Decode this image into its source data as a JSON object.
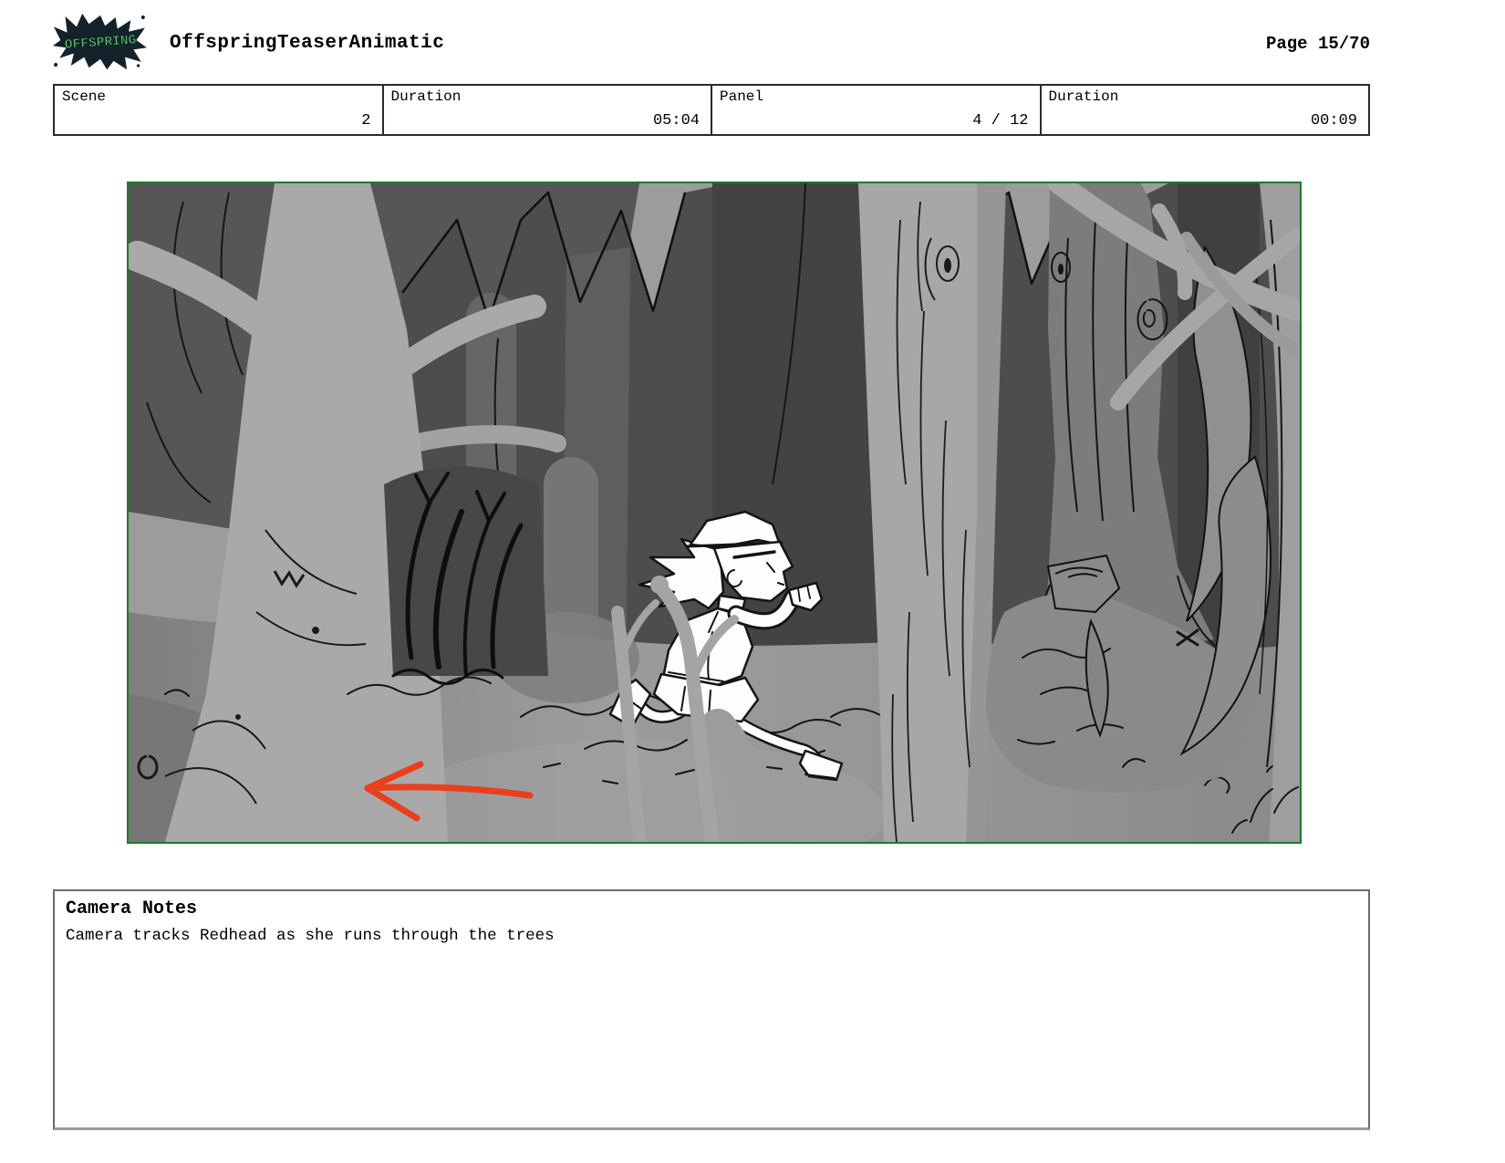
{
  "header": {
    "logo_text": "OFFSPRING",
    "title": "OffspringTeaserAnimatic",
    "page_label": "Page 15/70"
  },
  "info_table": {
    "cells": [
      {
        "label": "Scene",
        "value": "2"
      },
      {
        "label": "Duration",
        "value": "05:04"
      },
      {
        "label": "Panel",
        "value": "4 / 12"
      },
      {
        "label": "Duration",
        "value": "00:09"
      }
    ]
  },
  "storyboard_panel": {
    "description": "Grayscale forest scene: girl in cap and skirt sprinting between large tree trunks; hand-drawn red arrow at bottom pointing left",
    "border_color": "#1f7a2c",
    "arrow_color": "#e8401c"
  },
  "camera_notes": {
    "title": "Camera Notes",
    "text": "Camera tracks Redhead as she runs through the trees"
  }
}
